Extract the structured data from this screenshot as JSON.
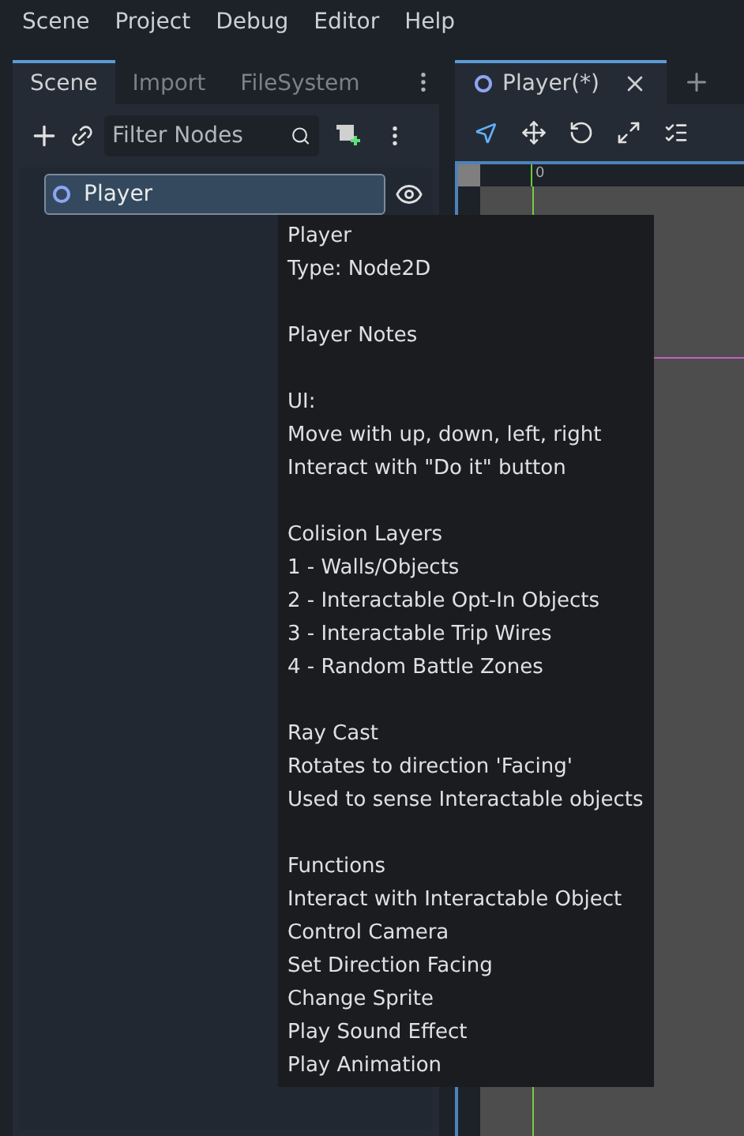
{
  "menu": [
    "Scene",
    "Project",
    "Debug",
    "Editor",
    "Help"
  ],
  "dock_tabs": [
    {
      "label": "Scene",
      "selected": true
    },
    {
      "label": "Import",
      "selected": false
    },
    {
      "label": "FileSystem",
      "selected": false
    }
  ],
  "filter": {
    "placeholder": "Filter Nodes"
  },
  "tree": [
    {
      "label": "Player",
      "selected": true,
      "visible": true
    }
  ],
  "scene_tabs": [
    {
      "label": "Player(*)",
      "selected": true
    }
  ],
  "ruler": {
    "mark": "0"
  },
  "tooltip": [
    [
      "Player",
      "Type: Node2D"
    ],
    [
      "Player Notes"
    ],
    [
      "UI:",
      "Move with up, down, left, right",
      "Interact with \"Do it\" button"
    ],
    [
      "Colision Layers",
      "1 - Walls/Objects",
      "2 - Interactable Opt-In Objects",
      "3 - Interactable Trip Wires",
      "4 - Random Battle Zones"
    ],
    [
      "Ray Cast",
      "Rotates to direction 'Facing'",
      "Used to sense Interactable objects"
    ],
    [
      "Functions",
      "Interact with Interactable Object",
      "Control Camera",
      "Set Direction Facing",
      "Change Sprite",
      "Play Sound Effect",
      "Play Animation"
    ]
  ]
}
